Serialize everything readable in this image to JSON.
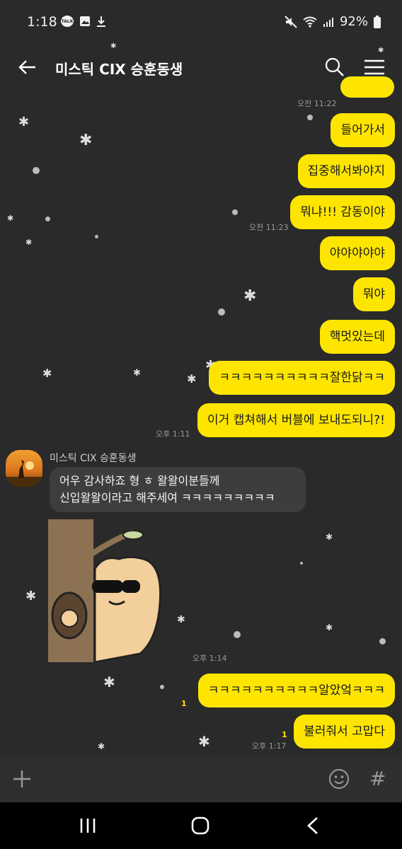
{
  "status_bar": {
    "time": "1:18",
    "talk_badge": "TALK",
    "battery": "92%",
    "icons": [
      "kakaotalk-icon",
      "image-icon",
      "download-icon",
      "mute-icon",
      "wifi-icon",
      "signal-icon",
      "battery-icon"
    ]
  },
  "header": {
    "title": "미스틱 CIX 승훈동생"
  },
  "messages_out_top": [
    {
      "text": "들어가서"
    },
    {
      "text": "집중해서봐야지"
    },
    {
      "text": "뭐냐!!! 감동이야"
    },
    {
      "text": "야야야야야"
    },
    {
      "text": "뭐야"
    },
    {
      "text": "핵멋있는데"
    },
    {
      "text": "ㅋㅋㅋㅋㅋㅋㅋㅋㅋㅋ잘한닭ㅋㅋ"
    },
    {
      "text": "이거 캡쳐해서 버블에 보내도되니?!"
    }
  ],
  "timestamps": {
    "t1122": "오전 11:22",
    "t1123": "오전 11:23",
    "t111": "오후 1:11",
    "t114": "오후 1:14",
    "t117": "오후 1:17"
  },
  "incoming": {
    "sender": "미스틱 CIX 승훈동생",
    "line1": "어우 감사하죠 형 ㅎ 왈왈이분들께",
    "line2": "신입왈왈이라고 해주세여 ㅋㅋㅋㅋㅋㅋㅋㅋㅋ"
  },
  "messages_out_bottom": [
    {
      "text": "ㅋㅋㅋㅋㅋㅋㅋㅋㅋㅋ알았엌ㅋㅋㅋ",
      "unread": "1"
    },
    {
      "text": "불러줘서 고맙다",
      "unread": "1"
    }
  ],
  "colors": {
    "background": "#2a2a2a",
    "bubble_out": "#fee500",
    "bubble_in": "#3d3d3d",
    "unread": "#fee500"
  }
}
